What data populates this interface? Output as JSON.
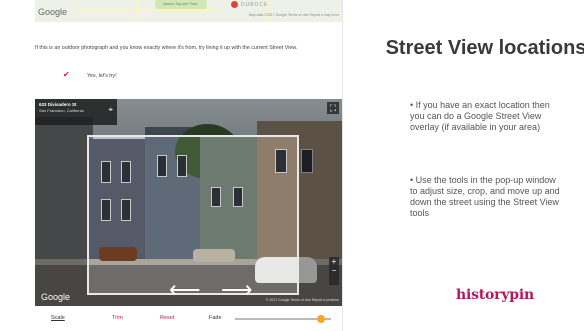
{
  "map": {
    "google_label": "Google",
    "park_label": "Alamo Square Park",
    "place_label": "DUBOCE",
    "terms": "Map data ©2017 Google   Terms of Use   Report a map error"
  },
  "instructions": "If this is an outdoor photograph and you know exactly where it's from, try lining it up with the current Street View.",
  "checkbox": {
    "checked": true,
    "label": "Yes, let's try!"
  },
  "street_view": {
    "address_title": "633 Divisadero St",
    "address_sub": "San Francisco, California",
    "google_label": "Google",
    "terms": "© 2017 Google   Terms of Use   Report a problem"
  },
  "tools": {
    "scale": "Scale",
    "trim": "Trim",
    "reset": "Reset",
    "fade": "Fade",
    "fade_level": 0.9
  },
  "slide": {
    "title": "Street View locations",
    "bullets": [
      "• If you have an exact location then you can do a Google Street View overlay (if available in your area)",
      "• Use the tools in the pop-up window to adjust size, crop, and move up and down the street using the Street View tools"
    ],
    "logo": "historypin",
    "brand_color": "#b0195a"
  }
}
